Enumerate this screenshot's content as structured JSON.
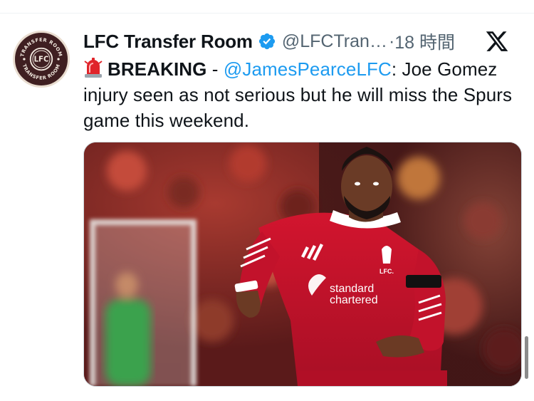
{
  "tweet": {
    "display_name": "LFC Transfer Room",
    "handle": "@LFCTran…",
    "separator": "·",
    "time": "18 時間",
    "avatar_text_top": "TRANSFER ROOM",
    "avatar_text_bottom": "TRANSFER ROOM",
    "avatar_monogram": "LFC",
    "breaking_label": "BREAKING",
    "dash": " - ",
    "mention": "@JamesPearceLFC",
    "body": ": Joe Gomez injury seen as not serious but he will miss the Spurs game this weekend.",
    "media": {
      "shirt_sponsor_1": "standard",
      "shirt_sponsor_2": "chartered",
      "crest_text": "LFC."
    }
  },
  "icons": {
    "verified": "verified-badge-icon",
    "siren": "rotating-light-icon",
    "platform": "x-logo-icon"
  },
  "colors": {
    "accent": "#1d9bf0",
    "text": "#0f1419",
    "muted": "#536471",
    "avatar_bg": "#3f1f21",
    "shirt_red": "#c8102e"
  }
}
